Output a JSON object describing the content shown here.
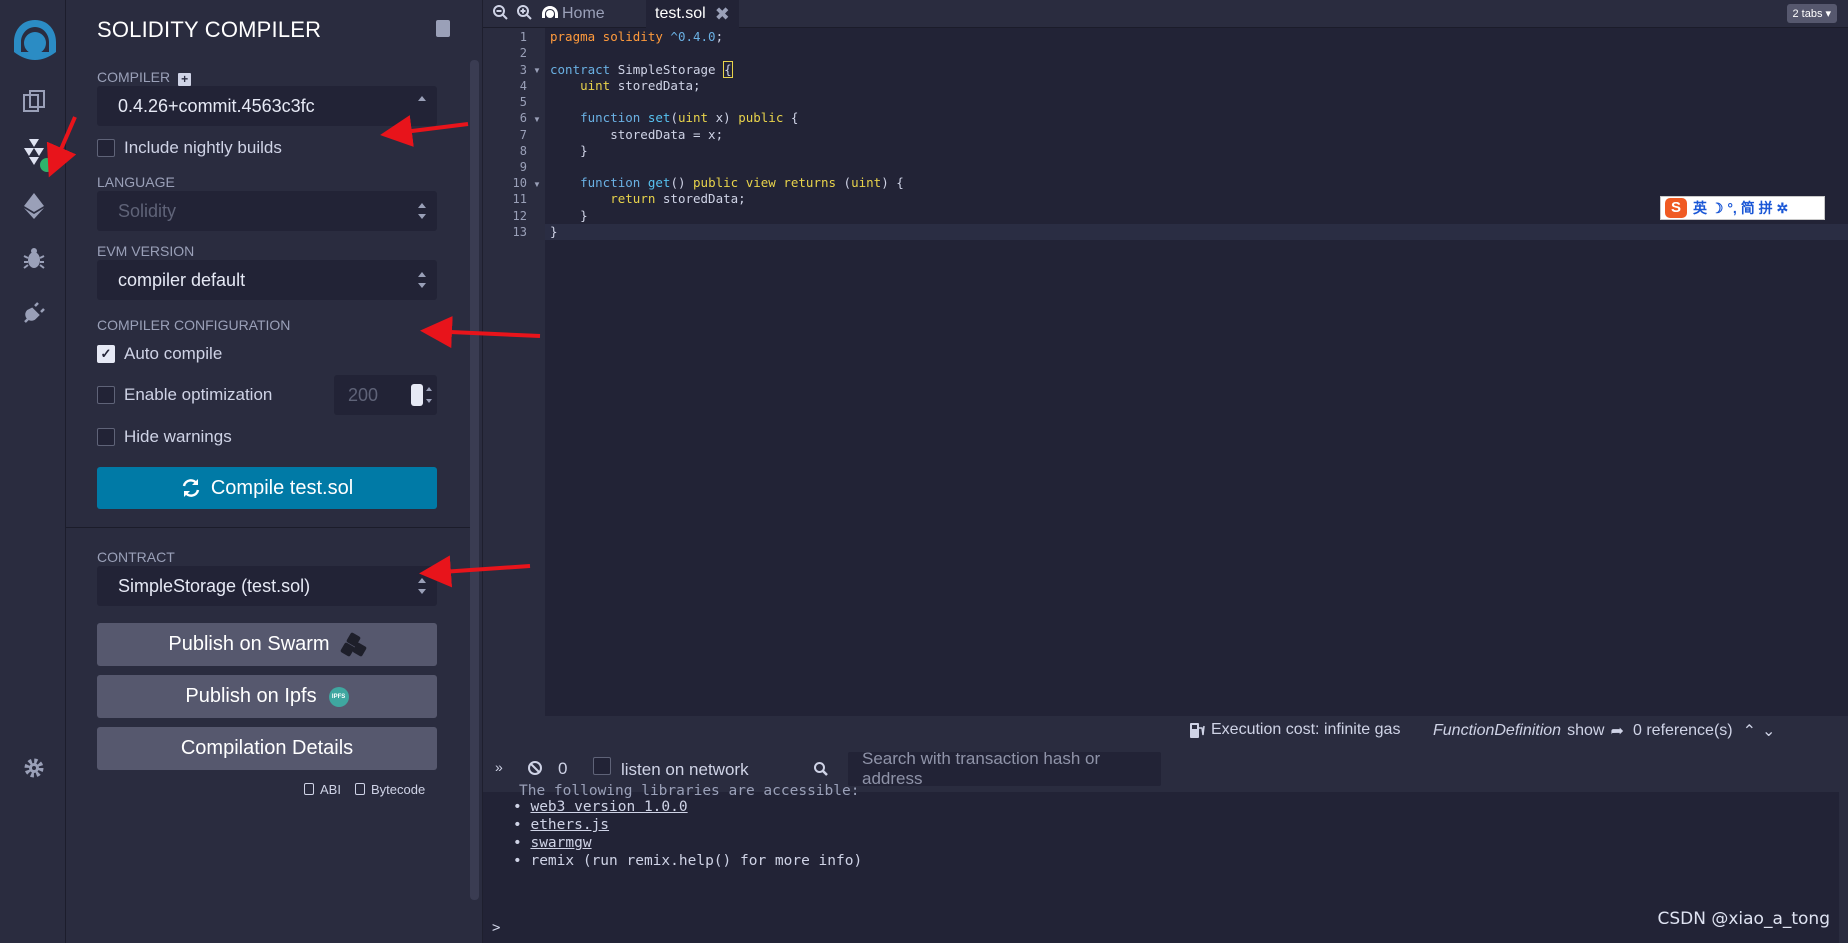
{
  "panel": {
    "title": "SOLIDITY COMPILER",
    "compiler_label": "COMPILER",
    "compiler_value": "0.4.26+commit.4563c3fc",
    "nightly_label": "Include nightly builds",
    "language_label": "LANGUAGE",
    "language_value": "Solidity",
    "evm_label": "EVM VERSION",
    "evm_value": "compiler default",
    "config_label": "COMPILER CONFIGURATION",
    "auto_compile_label": "Auto compile",
    "auto_compile_checked": true,
    "optimization_label": "Enable optimization",
    "optimization_runs": "200",
    "hide_warnings_label": "Hide warnings",
    "compile_button": "Compile test.sol",
    "contract_label": "CONTRACT",
    "contract_value": "SimpleStorage (test.sol)",
    "publish_swarm": "Publish on Swarm",
    "publish_ipfs": "Publish on Ipfs",
    "ipfs_badge": "IPFS",
    "compilation_details": "Compilation Details",
    "abi_label": "ABI",
    "bytecode_label": "Bytecode"
  },
  "tabs": {
    "home": "Home",
    "active": "test.sol",
    "count": "2 tabs"
  },
  "editor": {
    "lines": [
      "1",
      "2",
      "3",
      "4",
      "5",
      "6",
      "7",
      "8",
      "9",
      "10",
      "11",
      "12",
      "13"
    ],
    "code": {
      "l1a": "pragma solidity ",
      "l1b": "^0.4.0",
      "l1c": ";",
      "l3a": "contract ",
      "l3b": "SimpleStorage ",
      "l3c": "{",
      "l4a": "    ",
      "l4b": "uint",
      "l4c": " storedData;",
      "l6a": "    ",
      "l6b": "function",
      "l6c": " set",
      "l6d": "(",
      "l6e": "uint",
      "l6f": " x) ",
      "l6g": "public",
      "l6h": " {",
      "l7": "        storedData = x;",
      "l8": "    }",
      "l10a": "    ",
      "l10b": "function",
      "l10c": " get",
      "l10d": "() ",
      "l10e": "public",
      "l10f": " ",
      "l10g": "view",
      "l10h": " ",
      "l10i": "returns",
      "l10j": " (",
      "l10k": "uint",
      "l10l": ") {",
      "l11a": "        ",
      "l11b": "return",
      "l11c": " storedData;",
      "l12": "    }",
      "l13": "}"
    }
  },
  "ime": {
    "logo": "S",
    "text": "英 ☽ °, 简 拼 ✲"
  },
  "status": {
    "execution_cost": "Execution cost: infinite gas",
    "definition": "FunctionDefinition",
    "show": "show",
    "references": "0 reference(s)"
  },
  "terminal": {
    "pending_count": "0",
    "listen_label": "listen on network",
    "search_placeholder": "Search with transaction hash or address",
    "partial_line": "The following libraries are accessible:",
    "libs": [
      "web3 version 1.0.0",
      "ethers.js",
      "swarmgw",
      "remix (run remix.help() for more info)"
    ],
    "prompt": ">"
  },
  "watermark": "CSDN @xiao_a_tong",
  "colors": {
    "accent": "#007aa6",
    "background": "#222336",
    "panel": "#2a2c3f",
    "success": "#2fb36b",
    "annotation_arrow": "#e8141b"
  }
}
